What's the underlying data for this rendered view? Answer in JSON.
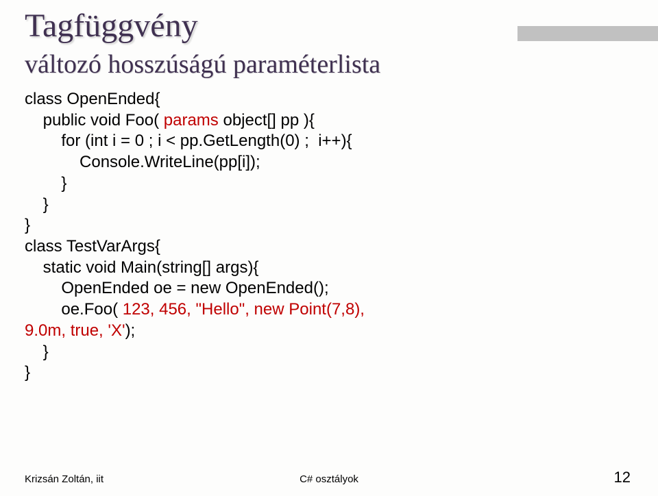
{
  "title": "Tagfüggvény",
  "subtitle": "változó hosszúságú paraméterlista",
  "code": {
    "l1": "class OpenEnded{",
    "l2a": "    public void Foo( ",
    "l2b": "params",
    "l2c": " object[] pp ){",
    "l3": "        for (int i = 0 ; i < pp.GetLength(0) ;  i++){",
    "l4": "            Console.WriteLine(pp[i]);",
    "l5": "        }",
    "l6": "    }",
    "l7": "}",
    "l8": "class TestVarArgs{",
    "l9": "    static void Main(string[] args){",
    "l10": "        OpenEnded oe = new OpenEnded();",
    "l11a": "        oe.Foo( ",
    "l11b": "123, 456, \"Hello\", new Point(7,8),",
    "l12a": "9.0m, true, 'X'",
    "l12b": ");",
    "l13": "    }",
    "l14": "}"
  },
  "footer_left": "Krizsán Zoltán, iit",
  "footer_center": "C# osztályok",
  "page_number": "12"
}
